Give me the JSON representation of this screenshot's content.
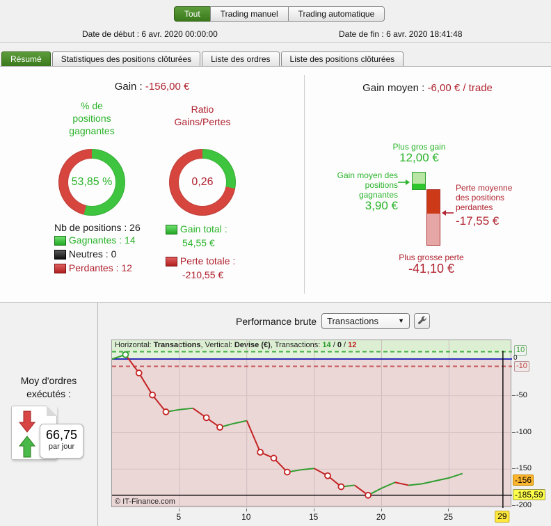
{
  "colors": {
    "accent_green": "#2ab42a",
    "accent_red": "#b02330",
    "tab_green": "#3a7a1c",
    "curve_win": "#2f9e2f",
    "curve_loss": "#c32222",
    "zero_line": "#2b2bb8",
    "current_box": "#fdb52d",
    "min_box": "#feff4a",
    "cursor_box": "#ffe83d"
  },
  "top_bar": {
    "tabs": [
      {
        "label": "Tout"
      },
      {
        "label": "Trading manuel"
      },
      {
        "label": "Trading automatique"
      }
    ],
    "date_start_label": "Date de début :",
    "date_start_value": "6 avr. 2020 00:00:00",
    "date_end_label": "Date de fin :",
    "date_end_value": "6 avr. 2020 18:41:48"
  },
  "nav_tabs": [
    {
      "label": "Résumé"
    },
    {
      "label": "Statistiques des positions clôturées"
    },
    {
      "label": "Liste des ordres"
    },
    {
      "label": "Liste des positions clôturées"
    }
  ],
  "summary": {
    "gain_label": "Gain :",
    "gain_value": "-156,00 €",
    "winning_donut": {
      "title_line1": "% de",
      "title_line2": "positions",
      "title_line3": "gagnantes",
      "center_value": "53,85 %",
      "green_pct": 53.85
    },
    "ratio_donut": {
      "title_line1": "Ratio",
      "title_line2": "Gains/Pertes",
      "center_value": "0,26",
      "green_pct": 28
    },
    "positions": {
      "total_label": "Nb de positions : 26",
      "winning_label": "Gagnantes : 14",
      "neutral_label": "Neutres : 0",
      "losing_label": "Perdantes : 12"
    },
    "totals": {
      "gain_total_label": "Gain total :",
      "gain_total_value": "54,55 €",
      "loss_total_label": "Perte totale :",
      "loss_total_value": "-210,55 €"
    }
  },
  "average_panel": {
    "title_label": "Gain moyen :",
    "title_value": "-6,00 € / trade",
    "biggest_gain_label": "Plus gros gain",
    "biggest_gain_value": "12,00 €",
    "avg_win_line1": "Gain moyen des",
    "avg_win_line2": "positions",
    "avg_win_line3": "gagnantes",
    "avg_win_value": "3,90 €",
    "avg_loss_line1": "Perte moyenne",
    "avg_loss_line2": "des positions",
    "avg_loss_line3": "perdantes",
    "avg_loss_value": "-17,55 €",
    "biggest_loss_label": "Plus grosse perte",
    "biggest_loss_value": "-41,10 €"
  },
  "performance": {
    "label": "Performance brute",
    "select_value": "Transactions",
    "avg_orders_line1": "Moy d'ordres",
    "avg_orders_line2": "exécutés :",
    "avg_orders_value": "66,75",
    "avg_orders_unit": "par jour",
    "copyright": "© IT-Finance.com"
  },
  "chart_data": {
    "type": "line",
    "title": "Performance brute",
    "xlabel": "Transactions",
    "ylabel": "Devise (€)",
    "header": {
      "h_label": "Horizontal: ",
      "h_value": "Transactions",
      "sep1": ", ",
      "v_label": "Vertical: ",
      "v_value": "Devise (€)",
      "sep2": ", ",
      "t_label": "Transactions: ",
      "wins": "14",
      "slash1": " / ",
      "neutral": "0",
      "slash2": " / ",
      "losses": "12"
    },
    "x": [
      0,
      1,
      2,
      3,
      4,
      5,
      6,
      7,
      8,
      9,
      10,
      11,
      12,
      13,
      14,
      15,
      16,
      17,
      18,
      19,
      20,
      21,
      22,
      23,
      24,
      25,
      26
    ],
    "values": [
      0,
      6,
      -19,
      -49,
      -72,
      -69,
      -67,
      -80,
      -93,
      -88,
      -84,
      -127,
      -135,
      -154,
      -151,
      -149,
      -159,
      -174,
      -172,
      -185.59,
      -176,
      -168,
      -172,
      -170,
      -166,
      -162,
      -156
    ],
    "marker_indices": [
      1,
      2,
      3,
      4,
      7,
      8,
      11,
      12,
      13,
      16,
      17,
      19
    ],
    "x_ticks": [
      5,
      10,
      15,
      20,
      25
    ],
    "x_cursor": 29,
    "x_cursor_label": "29",
    "y_ticks": [
      10,
      0,
      -10
    ],
    "y_grid": [
      -50,
      -100,
      -150,
      -200
    ],
    "ref_upper": 10,
    "ref_zero": 0,
    "ref_lower": -10,
    "min_value": -185.59,
    "current_value_label": "-156",
    "min_value_label": "-185,59",
    "ylim": [
      -200,
      15
    ],
    "xlim": [
      0,
      29.7
    ],
    "grid": true,
    "legend_position": "none"
  }
}
